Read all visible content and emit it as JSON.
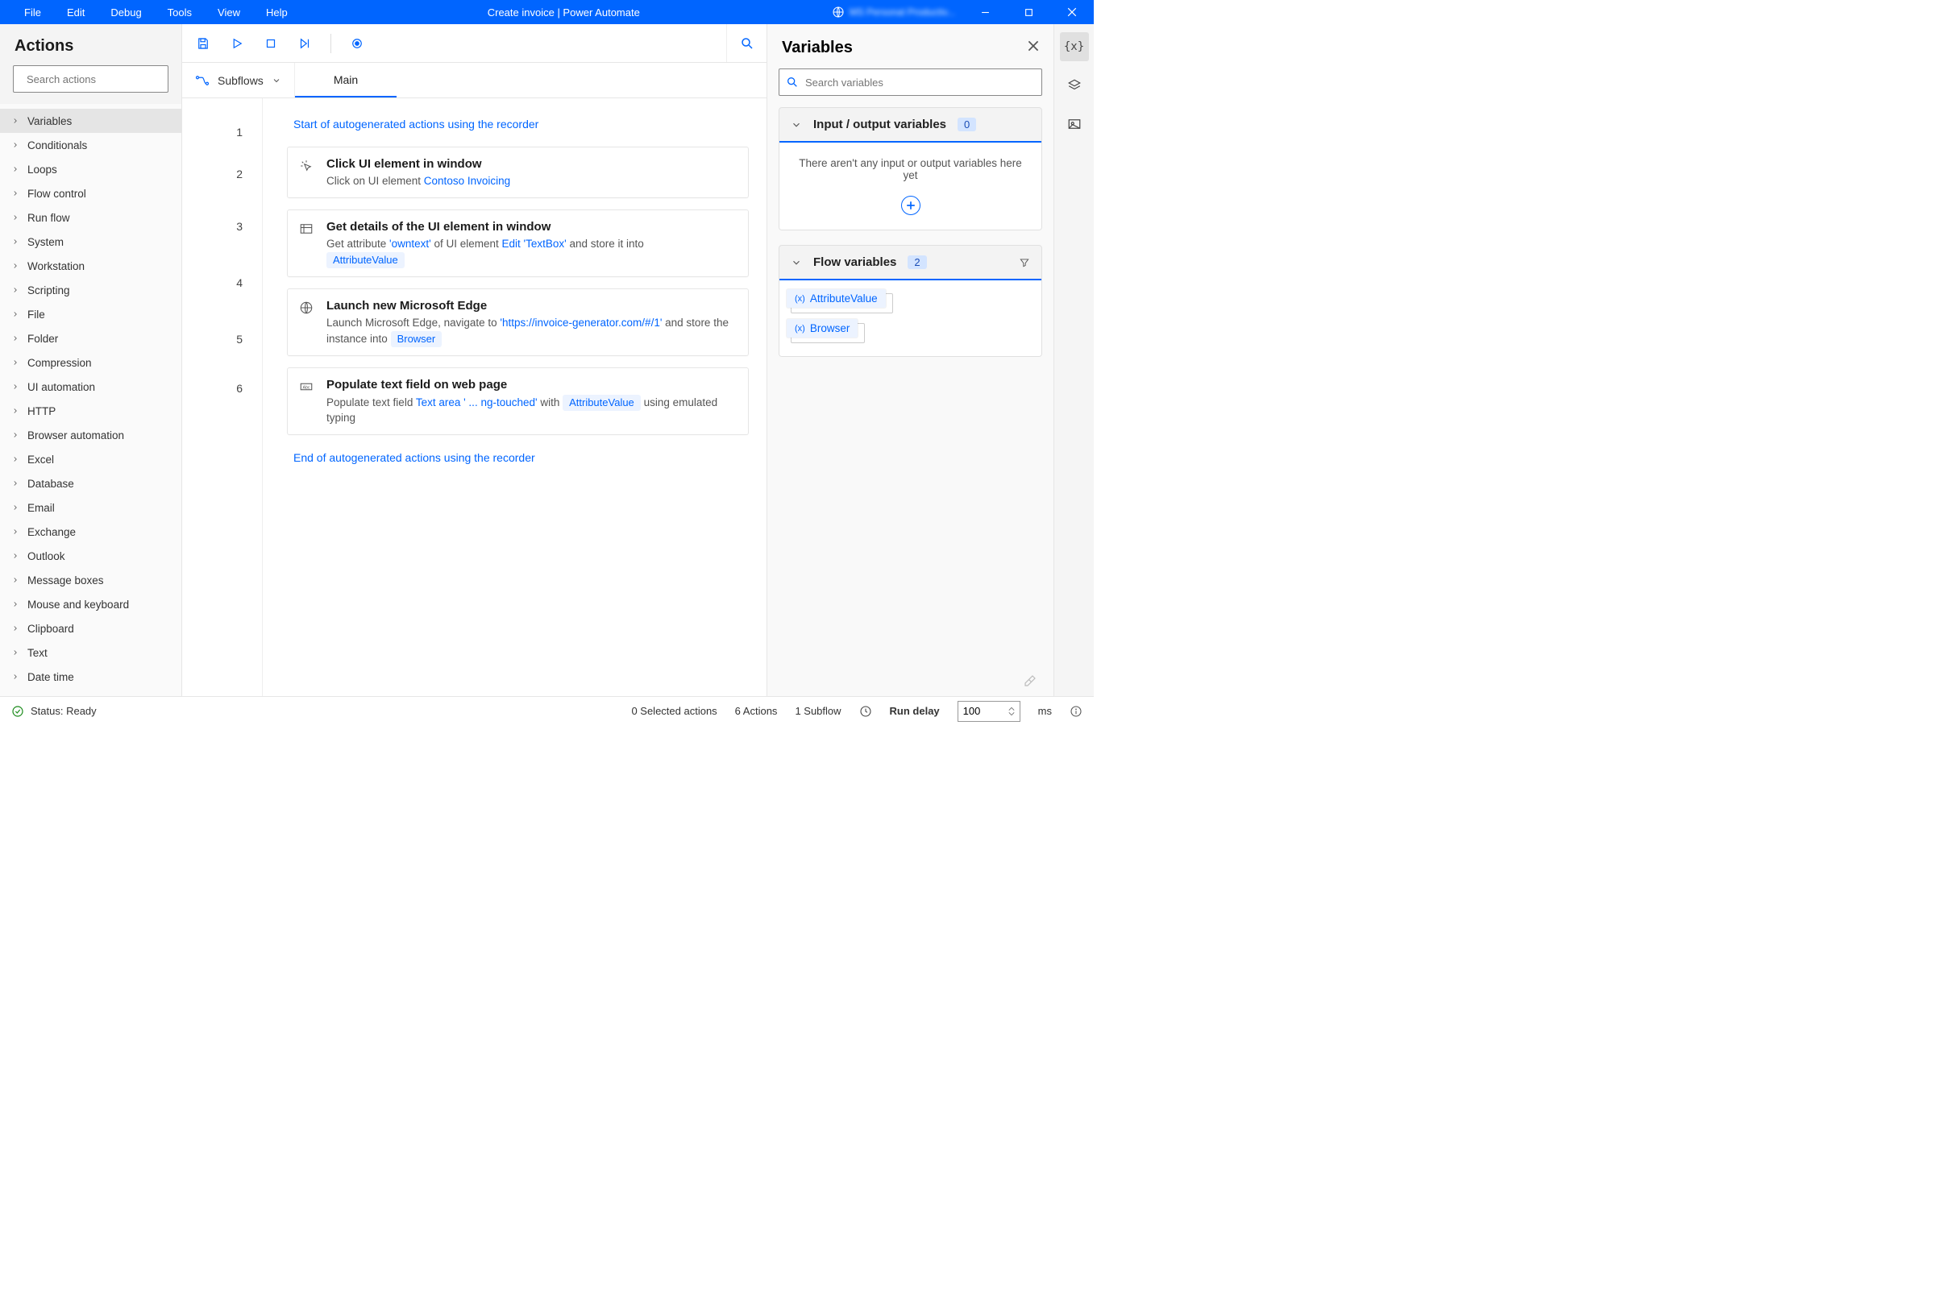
{
  "titlebar": {
    "menu": [
      "File",
      "Edit",
      "Debug",
      "Tools",
      "View",
      "Help"
    ],
    "title": "Create invoice | Power Automate",
    "environment_redacted": "MS Personal Productiv..."
  },
  "actions_panel": {
    "title": "Actions",
    "search_placeholder": "Search actions",
    "categories": [
      "Variables",
      "Conditionals",
      "Loops",
      "Flow control",
      "Run flow",
      "System",
      "Workstation",
      "Scripting",
      "File",
      "Folder",
      "Compression",
      "UI automation",
      "HTTP",
      "Browser automation",
      "Excel",
      "Database",
      "Email",
      "Exchange",
      "Outlook",
      "Message boxes",
      "Mouse and keyboard",
      "Clipboard",
      "Text",
      "Date time"
    ],
    "selected": "Variables"
  },
  "subflows": {
    "label": "Subflows",
    "tab": "Main"
  },
  "steps": [
    {
      "n": "1",
      "type": "comment",
      "text": "Start of autogenerated actions using the recorder"
    },
    {
      "n": "2",
      "type": "card",
      "icon": "click",
      "title": "Click UI element in window",
      "desc_pre": "Click on UI element ",
      "link1": "Contoso Invoicing"
    },
    {
      "n": "3",
      "type": "card",
      "icon": "details",
      "title": "Get details of the UI element in window",
      "desc_pre": "Get attribute ",
      "q1": "'owntext'",
      "mid": " of UI element ",
      "link1": "Edit 'TextBox'",
      "tail": " and store it into ",
      "chip": "AttributeValue"
    },
    {
      "n": "4",
      "type": "card",
      "icon": "globe",
      "title": "Launch new Microsoft Edge",
      "desc_pre": "Launch Microsoft Edge, navigate to ",
      "link1": "'https://invoice-generator.com/#/1'",
      "tail": " and store the instance into ",
      "chip": "Browser"
    },
    {
      "n": "5",
      "type": "card",
      "icon": "abc",
      "title": "Populate text field on web page",
      "desc_pre": "Populate text field ",
      "link1": "Text area ' ... ng-touched'",
      "mid": " with ",
      "chip": "AttributeValue",
      "tail2": " using emulated typing"
    },
    {
      "n": "6",
      "type": "comment",
      "text": "End of autogenerated actions using the recorder"
    }
  ],
  "variables_panel": {
    "title": "Variables",
    "search_placeholder": "Search variables",
    "io_section": {
      "title": "Input / output variables",
      "count": "0",
      "empty_text": "There aren't any input or output variables here yet"
    },
    "flow_section": {
      "title": "Flow variables",
      "count": "2",
      "vars": [
        "AttributeValue",
        "Browser"
      ]
    }
  },
  "statusbar": {
    "status": "Status: Ready",
    "selected": "0 Selected actions",
    "actions": "6 Actions",
    "subflow": "1 Subflow",
    "run_delay_label": "Run delay",
    "run_delay_value": "100",
    "ms": "ms"
  }
}
